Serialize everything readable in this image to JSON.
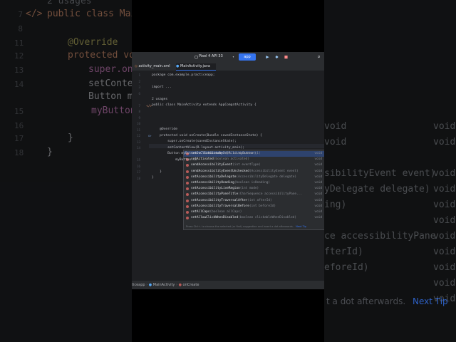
{
  "background": {
    "left_lines": [
      {
        "num": "",
        "text": "2 usages"
      },
      {
        "num": "7",
        "text": "public class Main"
      },
      {
        "num": "8",
        "text": ""
      },
      {
        "num": "11",
        "text": "@Override"
      },
      {
        "num": "12",
        "text": "protected voi"
      },
      {
        "num": "13",
        "text": "super.onC"
      },
      {
        "num": "14",
        "text": "setConten"
      },
      {
        "num": "",
        "text": "Button my"
      },
      {
        "num": "15",
        "text": "myButton"
      },
      {
        "num": "16",
        "text": ""
      },
      {
        "num": "17",
        "text": "}"
      },
      {
        "num": "18",
        "text": "}"
      }
    ],
    "right_lines": [
      {
        "text": "void",
        "type": "void"
      },
      {
        "text": "void",
        "type": "void"
      },
      {
        "text": "sibilityEvent event)",
        "type": "void"
      },
      {
        "text": "yDelegate delegate)",
        "type": "void"
      },
      {
        "text": "ing)",
        "type": "void"
      },
      {
        "text": "",
        "type": "void"
      },
      {
        "text": "ce accessibilityPane",
        "type": "void"
      },
      {
        "text": "fterId)",
        "type": "void"
      },
      {
        "text": "eforeId)",
        "type": "void"
      },
      {
        "text": "",
        "type": "void"
      },
      {
        "text": "",
        "type": "void"
      }
    ],
    "bottom_hint": "t a dot afterwards.",
    "bottom_next_tip": "Next Tip"
  },
  "toolbar": {
    "device": "Pixel 4 API 33",
    "run_config": "app"
  },
  "tabs": [
    {
      "label": "activity_main.xml",
      "active": false
    },
    {
      "label": "MainActivity.java",
      "active": true
    }
  ],
  "editor": {
    "lines": [
      {
        "num": "1",
        "text": "package com.example.practiceapp;"
      },
      {
        "num": "2",
        "text": ""
      },
      {
        "num": "3",
        "text": "import ..."
      },
      {
        "num": "6",
        "text": ""
      },
      {
        "num": "",
        "text": "2 usages"
      },
      {
        "num": "7",
        "text": "public class MainActivity extends AppCompatActivity {"
      },
      {
        "num": "8",
        "text": ""
      },
      {
        "num": "9",
        "text": ""
      },
      {
        "num": "10",
        "text": ""
      },
      {
        "num": "11",
        "text": "    @Override"
      },
      {
        "num": "12",
        "text": "    protected void onCreate(Bundle savedInstanceState) {"
      },
      {
        "num": "13",
        "text": "        super.onCreate(savedInstanceState);"
      },
      {
        "num": "14",
        "text": "        setContentView(R.layout.activity_main);"
      },
      {
        "num": "",
        "text": "        Button myButton = findViewById(R.id.myButton);"
      },
      {
        "num": "15",
        "text": "            myButton.se"
      },
      {
        "num": "16",
        "text": ""
      },
      {
        "num": "17",
        "text": "    }"
      },
      {
        "num": "18",
        "text": "}"
      }
    ]
  },
  "completion": {
    "items": [
      {
        "name": "setOnClickListener",
        "params": "(OnClickListener l)",
        "type": "void",
        "selected": true
      },
      {
        "name": "setActivated",
        "params": "(boolean activated)",
        "type": "void",
        "selected": false
      },
      {
        "name": "sendAccessibilityEvent",
        "params": "(int eventType)",
        "type": "void",
        "selected": false
      },
      {
        "name": "sendAccessibilityEventUnchecked",
        "params": "(AccessibilityEvent event)",
        "type": "void",
        "selected": false
      },
      {
        "name": "setAccessibilityDelegate",
        "params": "(AccessibilityDelegate delegate)",
        "type": "void",
        "selected": false
      },
      {
        "name": "setAccessibilityHeading",
        "params": "(boolean isHeading)",
        "type": "void",
        "selected": false
      },
      {
        "name": "setAccessibilityLiveRegion",
        "params": "(int mode)",
        "type": "void",
        "selected": false
      },
      {
        "name": "setAccessibilityPaneTitle",
        "params": "(CharSequence accessibilityPane...",
        "type": "void",
        "selected": false
      },
      {
        "name": "setAccessibilityTraversalAfter",
        "params": "(int afterId)",
        "type": "void",
        "selected": false
      },
      {
        "name": "setAccessibilityTraversalBefore",
        "params": "(int beforeId)",
        "type": "void",
        "selected": false
      },
      {
        "name": "setAllCaps",
        "params": "(boolean allCaps)",
        "type": "void",
        "selected": false
      },
      {
        "name": "setAllowClickWhenDisabled",
        "params": "(boolean clickableWhenDisabled)",
        "type": "void",
        "selected": false
      }
    ],
    "footer": "Press Ctrl+. to choose the selected (or first) suggestion and insert a dot afterwards.",
    "next_tip": "Next Tip"
  },
  "status_bar": {
    "crumb_project": "ticeapp",
    "crumb_class": "MainActivity",
    "crumb_method": "onCreate"
  },
  "colors": {
    "accent": "#3574f0",
    "editor_bg": "#1e1f22",
    "panel_bg": "#2b2d30",
    "selection": "#2e436e"
  }
}
